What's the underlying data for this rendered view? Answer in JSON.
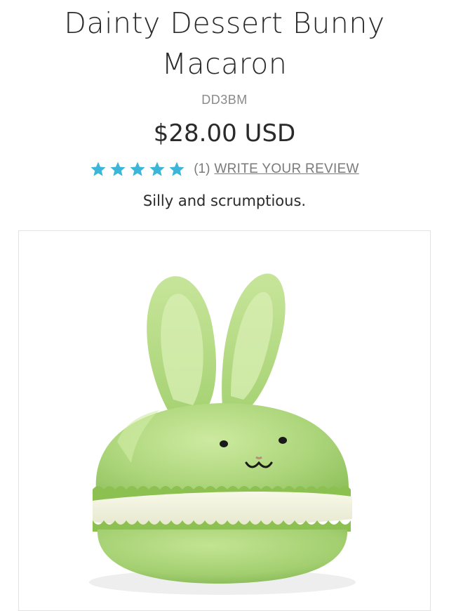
{
  "product": {
    "title": "Dainty Dessert Bunny Macaron",
    "sku": "DD3BM",
    "price": "$28.00 USD",
    "rating": {
      "stars": 5,
      "count_label": "(1)",
      "write_review_label": "WRITE YOUR REVIEW",
      "star_color": "#3bb5d8"
    },
    "tagline": "Silly and scrumptious.",
    "image": {
      "icon": "green-bunny-macaron-plush-image"
    }
  }
}
